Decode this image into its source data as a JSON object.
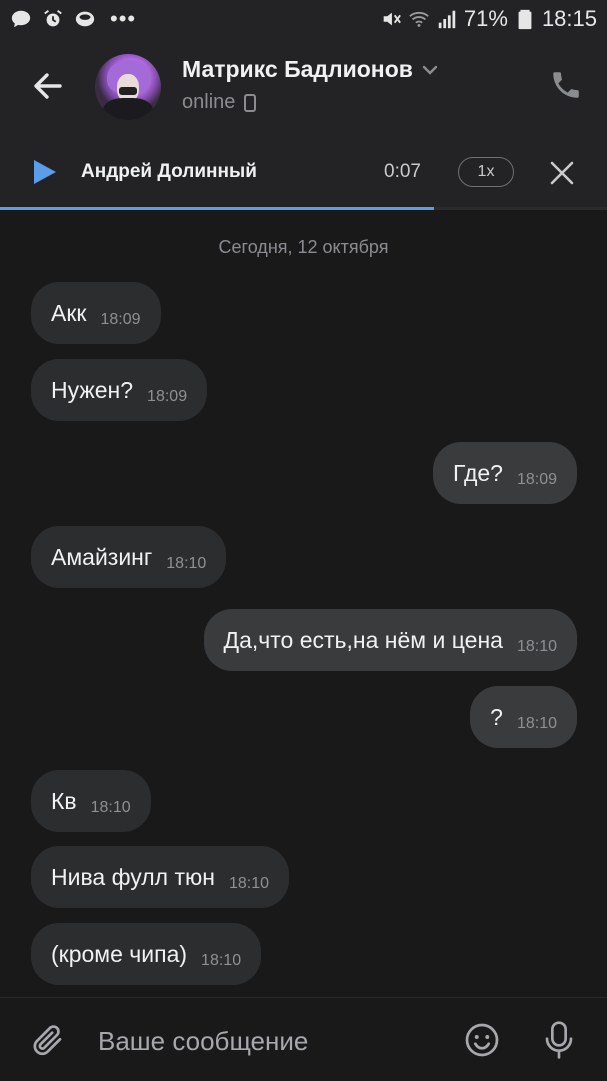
{
  "statusbar": {
    "battery": "71%",
    "time": "18:15",
    "overflow": "•••",
    "icons": [
      "chat-icon",
      "alarm-icon",
      "record-icon",
      "mute-icon",
      "wifi-icon",
      "signal-icon",
      "battery-icon"
    ]
  },
  "header": {
    "name": "Матрикс Бадлионов",
    "status": "online",
    "icons": [
      "back-arrow-icon",
      "chevron-down-icon",
      "phone-device-icon",
      "call-icon"
    ]
  },
  "player": {
    "track": "Андрей Долинный",
    "time": "0:07",
    "speed": "1x",
    "progress": 0.715,
    "accent": "#5b9de8"
  },
  "chat": {
    "date": "Сегодня, 12 октября",
    "messages": [
      {
        "text": "Акк",
        "time": "18:09",
        "dir": "in"
      },
      {
        "text": "Нужен?",
        "time": "18:09",
        "dir": "in"
      },
      {
        "text": "Где?",
        "time": "18:09",
        "dir": "out"
      },
      {
        "text": "Амайзинг",
        "time": "18:10",
        "dir": "in"
      },
      {
        "text": "Да,что есть,на нём и цена",
        "time": "18:10",
        "dir": "out"
      },
      {
        "text": "?",
        "time": "18:10",
        "dir": "out"
      },
      {
        "text": "Кв",
        "time": "18:10",
        "dir": "in"
      },
      {
        "text": "Нива фулл тюн",
        "time": "18:10",
        "dir": "in"
      },
      {
        "text": "(кроме чипа)",
        "time": "18:10",
        "dir": "in"
      }
    ]
  },
  "composer": {
    "placeholder": "Ваше сообщение",
    "icons": [
      "paperclip-icon",
      "emoji-icon",
      "microphone-icon"
    ]
  }
}
